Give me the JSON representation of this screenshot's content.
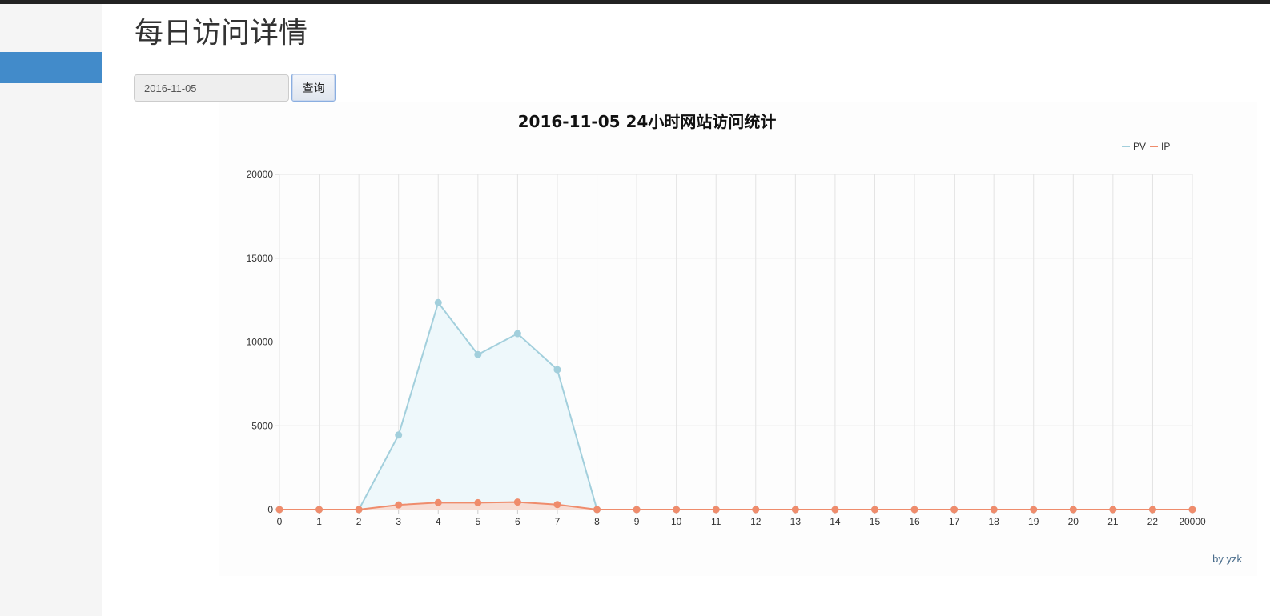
{
  "page": {
    "title": "每日访问详情",
    "date_value": "2016-11-05",
    "query_label": "查询",
    "footer": "by yzk"
  },
  "chart_data": {
    "type": "line",
    "title": "2016-11-05 24小时网站访问统计",
    "legend": [
      "PV",
      "IP"
    ],
    "legend_position": "top-right",
    "grid": true,
    "categories": [
      "0",
      "1",
      "2",
      "3",
      "4",
      "5",
      "6",
      "7",
      "8",
      "9",
      "10",
      "11",
      "12",
      "13",
      "14",
      "15",
      "16",
      "17",
      "18",
      "19",
      "20",
      "21",
      "22",
      "20000"
    ],
    "ylim": [
      0,
      20000
    ],
    "yticks": [
      0,
      5000,
      10000,
      15000,
      20000
    ],
    "series": [
      {
        "name": "PV",
        "color": "#a2cfdc",
        "fill": "#eef8fb",
        "values": [
          0,
          0,
          0,
          4450,
          12350,
          9250,
          10500,
          8350,
          0,
          0,
          0,
          0,
          0,
          0,
          0,
          0,
          0,
          0,
          0,
          0,
          0,
          0,
          0,
          0
        ]
      },
      {
        "name": "IP",
        "color": "#ef8c6c",
        "fill": "#f7ddd4",
        "values": [
          0,
          0,
          0,
          280,
          420,
          410,
          450,
          300,
          0,
          0,
          0,
          0,
          0,
          0,
          0,
          0,
          0,
          0,
          0,
          0,
          0,
          0,
          0,
          0
        ]
      }
    ]
  }
}
